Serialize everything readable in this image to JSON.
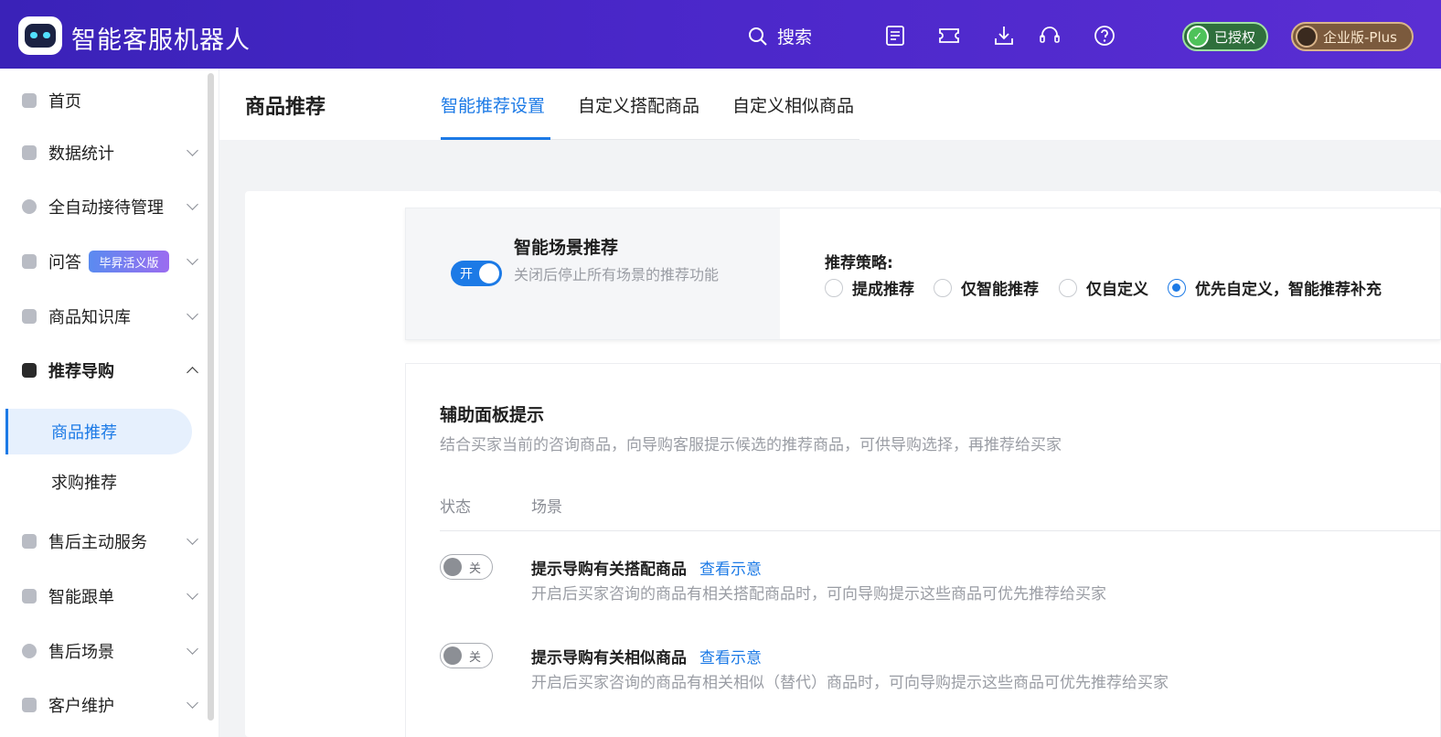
{
  "header": {
    "app_title": "智能客服机器人",
    "search_label": "搜索",
    "icons": [
      "list-icon",
      "ticket-icon",
      "download-icon",
      "headset-icon",
      "help-icon"
    ],
    "auth_badge": "已授权",
    "edition_badge": "企业版-Plus"
  },
  "sidebar": {
    "items": [
      {
        "label": "首页",
        "icon": "home-icon"
      },
      {
        "label": "数据统计",
        "icon": "chart-icon"
      },
      {
        "label": "全自动接待管理",
        "icon": "robot-icon"
      },
      {
        "label": "问答",
        "icon": "chat-icon",
        "tag": "毕昇活义版"
      },
      {
        "label": "商品知识库",
        "icon": "bag-icon"
      },
      {
        "label": "推荐导购",
        "icon": "recommend-icon"
      },
      {
        "label": "售后主动服务",
        "icon": "service-icon"
      },
      {
        "label": "智能跟单",
        "icon": "order-icon"
      },
      {
        "label": "售后场景",
        "icon": "after-sale-icon"
      },
      {
        "label": "客户维护",
        "icon": "customer-icon"
      }
    ],
    "sub_items": [
      {
        "label": "商品推荐",
        "active": true
      },
      {
        "label": "求购推荐",
        "active": false
      }
    ]
  },
  "page": {
    "title": "商品推荐",
    "tabs": [
      {
        "label": "智能推荐设置",
        "active": true
      },
      {
        "label": "自定义搭配商品",
        "active": false
      },
      {
        "label": "自定义相似商品",
        "active": false
      }
    ]
  },
  "scene": {
    "toggle_text": "开",
    "title": "智能场景推荐",
    "desc": "关闭后停止所有场景的推荐功能",
    "strategy_label": "推荐策略:",
    "options": [
      {
        "label": "提成推荐",
        "checked": false
      },
      {
        "label": "仅智能推荐",
        "checked": false
      },
      {
        "label": "仅自定义",
        "checked": false
      },
      {
        "label": "优先自定义，智能推荐补充",
        "checked": true
      }
    ]
  },
  "panel": {
    "title": "辅助面板提示",
    "desc": "结合买家当前的咨询商品，向导购客服提示候选的推荐商品，可供导购选择，再推荐给买家",
    "col_status": "状态",
    "col_scene": "场景",
    "rows": [
      {
        "toggle_text": "关",
        "title": "提示导购有关搭配商品",
        "link": "查看示意",
        "desc": "开启后买家咨询的商品有相关搭配商品时，可向导购提示这些商品可优先推荐给买家"
      },
      {
        "toggle_text": "关",
        "title": "提示导购有关相似商品",
        "link": "查看示意",
        "desc": "开启后买家咨询的商品有相关相似（替代）商品时，可向导购提示这些商品可优先推荐给买家"
      }
    ]
  },
  "colors": {
    "header": "#4a27c9",
    "accent": "#1c7ae6",
    "muted": "#9a9da4"
  }
}
